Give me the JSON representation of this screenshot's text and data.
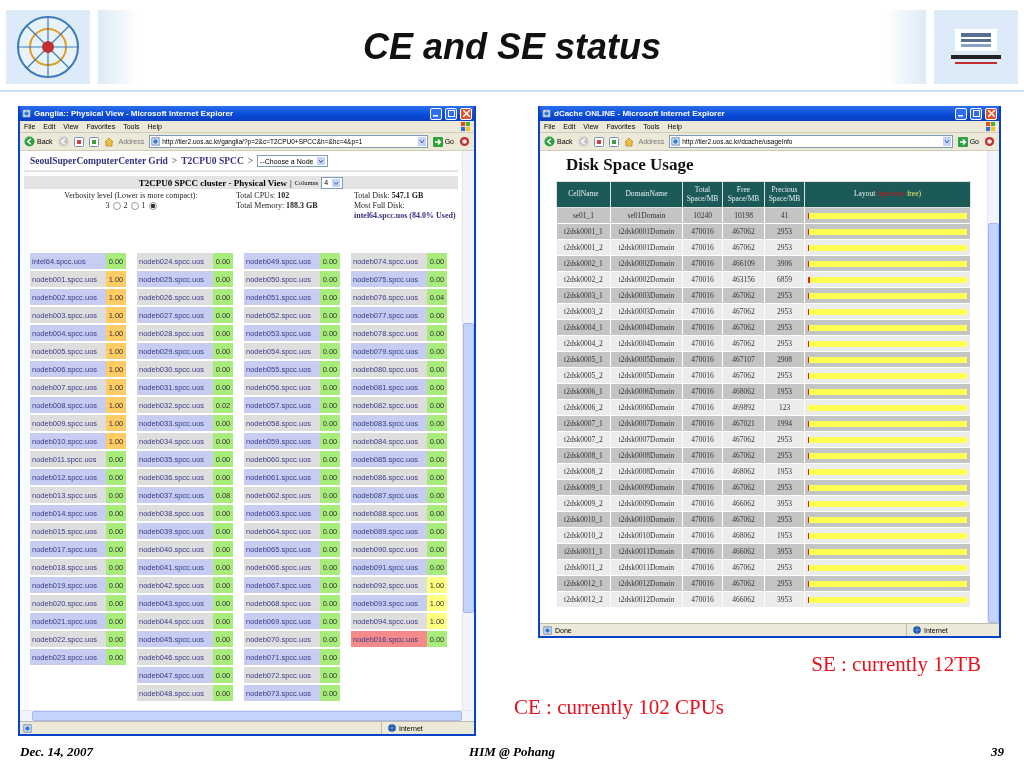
{
  "slide": {
    "title": "CE and SE status",
    "notes": [
      "SE : currently 12TB",
      "CE : currently 102 CPUs"
    ],
    "footer": {
      "date": "Dec. 14, 2007",
      "event": "HIM @ Pohang",
      "page": "39"
    }
  },
  "ganglia_window": {
    "title": "Ganglia:: Physical View - Microsoft Internet Explorer",
    "menu": [
      "File",
      "Edit",
      "View",
      "Favorites",
      "Tools",
      "Help"
    ],
    "back": "Back",
    "address_label": "Address",
    "url": "http://tier2.uos.ac.kr/ganglia/?p=2&c=T2CPU0+SPCC&h=&hc=4&p=1",
    "go": "Go",
    "status": "Internet",
    "breadcrumb": [
      {
        "kind": "link",
        "text": "SeoulSuperComputerCenter Grid"
      },
      {
        "kind": "separator",
        "text": ">"
      },
      {
        "kind": "link",
        "text": "T2CPU0 SPCC"
      },
      {
        "kind": "separator",
        "text": ">"
      }
    ],
    "node_select": "--Choose a Node",
    "cluster_heading": "T2CPU0 SPCC cluster - Physical View",
    "divider": "|",
    "columns_label": "Columns",
    "columns_value": "4",
    "verbosity_label": "Verbosity level (Lower is more compact):",
    "verbosity": [
      {
        "label": "3",
        "selected": false
      },
      {
        "label": "2",
        "selected": false
      },
      {
        "label": "1",
        "selected": true
      }
    ],
    "stats": [
      "Total CPUs: **102**",
      "Total Memory: **188.3 GB**"
    ],
    "disk_stats": [
      "Total Disk: **547.1 GB**",
      "Most Full Disk:"
    ],
    "most_full_link": "intel64.spcc.uos (84.0% Used)",
    "node_columns": [
      [
        {
          "name": "intel64.spcc.uos",
          "load": "0.00",
          "color": "#a8ec7c",
          "down": false
        },
        {
          "name": "nodeb001.spcc.uos",
          "load": "1.00",
          "color": "#ffcc66",
          "down": false
        },
        {
          "name": "nodeb002.spcc.uos",
          "load": "1.00",
          "color": "#ffcc66",
          "down": false
        },
        {
          "name": "nodeb003.spcc.uos",
          "load": "1.00",
          "color": "#ffcc66",
          "down": false
        },
        {
          "name": "nodeb004.spcc.uos",
          "load": "1.00",
          "color": "#ffcc66",
          "down": false
        },
        {
          "name": "nodeb005.spcc.uos",
          "load": "1.00",
          "color": "#ffcc66",
          "down": false
        },
        {
          "name": "nodeb006.spcc.uos",
          "load": "1.00",
          "color": "#ffcc66",
          "down": false
        },
        {
          "name": "nodeb007.spcc.uos",
          "load": "1.00",
          "color": "#ffcc66",
          "down": false
        },
        {
          "name": "nodeb008.spcc.uos",
          "load": "1.00",
          "color": "#ffcc66",
          "down": false
        },
        {
          "name": "nodeb009.spcc.uos",
          "load": "1.00",
          "color": "#ffcc66",
          "down": false
        },
        {
          "name": "nodeb010.spcc.uos",
          "load": "1.00",
          "color": "#ffcc66",
          "down": false
        },
        {
          "name": "nodeb011.spcc.uos",
          "load": "0.00",
          "color": "#a8ec7c",
          "down": false
        },
        {
          "name": "nodeb012.spcc.uos",
          "load": "0.00",
          "color": "#a8ec7c",
          "down": false
        },
        {
          "name": "nodeb013.spcc.uos",
          "load": "0.00",
          "color": "#a8ec7c",
          "down": false
        },
        {
          "name": "nodeb014.spcc.uos",
          "load": "0.00",
          "color": "#a8ec7c",
          "down": false
        },
        {
          "name": "nodeb015.spcc.uos",
          "load": "0.00",
          "color": "#a8ec7c",
          "down": false
        },
        {
          "name": "nodeb017.spcc.uos",
          "load": "0.00",
          "color": "#a8ec7c",
          "down": false
        },
        {
          "name": "nodeb018.spcc.uos",
          "load": "0.00",
          "color": "#a8ec7c",
          "down": false
        },
        {
          "name": "nodeb019.spcc.uos",
          "load": "0.00",
          "color": "#a8ec7c",
          "down": false
        },
        {
          "name": "nodeb020.spcc.uos",
          "load": "0.00",
          "color": "#a8ec7c",
          "down": false
        },
        {
          "name": "nodeb021.spcc.uos",
          "load": "0.00",
          "color": "#a8ec7c",
          "down": false
        },
        {
          "name": "nodeb022.spcc.uos",
          "load": "0.00",
          "color": "#a8ec7c",
          "down": false
        },
        {
          "name": "nodeb023.spcc.uos",
          "load": "0.00",
          "color": "#a8ec7c",
          "down": false
        }
      ],
      [
        {
          "name": "nodeb024.spcc.uos",
          "load": "0.00",
          "color": "#a8ec7c",
          "down": false
        },
        {
          "name": "nodeb025.spcc.uos",
          "load": "0.00",
          "color": "#a8ec7c",
          "down": false
        },
        {
          "name": "nodeb026.spcc.uos",
          "load": "0.00",
          "color": "#a8ec7c",
          "down": false
        },
        {
          "name": "nodeb027.spcc.uos",
          "load": "0.00",
          "color": "#a8ec7c",
          "down": false
        },
        {
          "name": "nodeb028.spcc.uos",
          "load": "0.00",
          "color": "#a8ec7c",
          "down": false
        },
        {
          "name": "nodeb029.spcc.uos",
          "load": "0.00",
          "color": "#a8ec7c",
          "down": false
        },
        {
          "name": "nodeb030.spcc.uos",
          "load": "0.00",
          "color": "#a8ec7c",
          "down": false
        },
        {
          "name": "nodeb031.spcc.uos",
          "load": "0.00",
          "color": "#a8ec7c",
          "down": false
        },
        {
          "name": "nodeb032.spcc.uos",
          "load": "0.02",
          "color": "#a8ec7c",
          "down": false
        },
        {
          "name": "nodeb033.spcc.uos",
          "load": "0.00",
          "color": "#a8ec7c",
          "down": false
        },
        {
          "name": "nodeb034.spcc.uos",
          "load": "0.00",
          "color": "#a8ec7c",
          "down": false
        },
        {
          "name": "nodeb035.spcc.uos",
          "load": "0.00",
          "color": "#a8ec7c",
          "down": false
        },
        {
          "name": "nodeb036.spcc.uos",
          "load": "0.00",
          "color": "#a8ec7c",
          "down": false
        },
        {
          "name": "nodeb037.spcc.uos",
          "load": "0.08",
          "color": "#a8ec7c",
          "down": false
        },
        {
          "name": "nodeb038.spcc.uos",
          "load": "0.00",
          "color": "#a8ec7c",
          "down": false
        },
        {
          "name": "nodeb039.spcc.uos",
          "load": "0.00",
          "color": "#a8ec7c",
          "down": false
        },
        {
          "name": "nodeb040.spcc.uos",
          "load": "0.00",
          "color": "#a8ec7c",
          "down": false
        },
        {
          "name": "nodeb041.spcc.uos",
          "load": "0.00",
          "color": "#a8ec7c",
          "down": false
        },
        {
          "name": "nodeb042.spcc.uos",
          "load": "0.00",
          "color": "#a8ec7c",
          "down": false
        },
        {
          "name": "nodeb043.spcc.uos",
          "load": "0.00",
          "color": "#a8ec7c",
          "down": false
        },
        {
          "name": "nodeb044.spcc.uos",
          "load": "0.00",
          "color": "#a8ec7c",
          "down": false
        },
        {
          "name": "nodeb045.spcc.uos",
          "load": "0.00",
          "color": "#a8ec7c",
          "down": false
        },
        {
          "name": "nodeb046.spcc.uos",
          "load": "0.00",
          "color": "#a8ec7c",
          "down": false
        },
        {
          "name": "nodeb047.spcc.uos",
          "load": "0.00",
          "color": "#a8ec7c",
          "down": false
        },
        {
          "name": "nodeb048.spcc.uos",
          "load": "0.00",
          "color": "#a8ec7c",
          "down": false
        }
      ],
      [
        {
          "name": "nodeb049.spcc.uos",
          "load": "0.00",
          "color": "#a8ec7c",
          "down": false
        },
        {
          "name": "nodeb050.spcc.uos",
          "load": "0.00",
          "color": "#a8ec7c",
          "down": false
        },
        {
          "name": "nodeb051.spcc.uos",
          "load": "0.00",
          "color": "#a8ec7c",
          "down": false
        },
        {
          "name": "nodeb052.spcc.uos",
          "load": "0.00",
          "color": "#a8ec7c",
          "down": false
        },
        {
          "name": "nodeb053.spcc.uos",
          "load": "0.00",
          "color": "#a8ec7c",
          "down": false
        },
        {
          "name": "nodeb054.spcc.uos",
          "load": "0.00",
          "color": "#a8ec7c",
          "down": false
        },
        {
          "name": "nodeb055.spcc.uos",
          "load": "0.00",
          "color": "#a8ec7c",
          "down": false
        },
        {
          "name": "nodeb056.spcc.uos",
          "load": "0.00",
          "color": "#a8ec7c",
          "down": false
        },
        {
          "name": "nodeb057.spcc.uos",
          "load": "0.00",
          "color": "#a8ec7c",
          "down": false
        },
        {
          "name": "nodeb058.spcc.uos",
          "load": "0.00",
          "color": "#a8ec7c",
          "down": false
        },
        {
          "name": "nodeb059.spcc.uos",
          "load": "0.00",
          "color": "#a8ec7c",
          "down": false
        },
        {
          "name": "nodeb060.spcc.uos",
          "load": "0.00",
          "color": "#a8ec7c",
          "down": false
        },
        {
          "name": "nodeb061.spcc.uos",
          "load": "0.00",
          "color": "#a8ec7c",
          "down": false
        },
        {
          "name": "nodeb062.spcc.uos",
          "load": "0.00",
          "color": "#a8ec7c",
          "down": false
        },
        {
          "name": "nodeb063.spcc.uos",
          "load": "0.00",
          "color": "#a8ec7c",
          "down": false
        },
        {
          "name": "nodeb064.spcc.uos",
          "load": "0.00",
          "color": "#a8ec7c",
          "down": false
        },
        {
          "name": "nodeb065.spcc.uos",
          "load": "0.00",
          "color": "#a8ec7c",
          "down": false
        },
        {
          "name": "nodeb066.spcc.uos",
          "load": "0.00",
          "color": "#a8ec7c",
          "down": false
        },
        {
          "name": "nodeb067.spcc.uos",
          "load": "0.00",
          "color": "#a8ec7c",
          "down": false
        },
        {
          "name": "nodeb068.spcc.uos",
          "load": "0.00",
          "color": "#a8ec7c",
          "down": false
        },
        {
          "name": "nodeb069.spcc.uos",
          "load": "0.00",
          "color": "#a8ec7c",
          "down": false
        },
        {
          "name": "nodeb070.spcc.uos",
          "load": "0.00",
          "color": "#a8ec7c",
          "down": false
        },
        {
          "name": "nodeb071.spcc.uos",
          "load": "0.00",
          "color": "#a8ec7c",
          "down": false
        },
        {
          "name": "nodeb072.spcc.uos",
          "load": "0.00",
          "color": "#a8ec7c",
          "down": false
        },
        {
          "name": "nodeb073.spcc.uos",
          "load": "0.00",
          "color": "#a8ec7c",
          "down": false
        }
      ],
      [
        {
          "name": "nodeb074.spcc.uos",
          "load": "0.00",
          "color": "#a8ec7c",
          "down": false
        },
        {
          "name": "nodeb075.spcc.uos",
          "load": "0.00",
          "color": "#a8ec7c",
          "down": false
        },
        {
          "name": "nodeb076.spcc.uos",
          "load": "0.04",
          "color": "#a8ec7c",
          "down": false
        },
        {
          "name": "nodeb077.spcc.uos",
          "load": "0.00",
          "color": "#a8ec7c",
          "down": false
        },
        {
          "name": "nodeb078.spcc.uos",
          "load": "0.00",
          "color": "#a8ec7c",
          "down": false
        },
        {
          "name": "nodeb079.spcc.uos",
          "load": "0.00",
          "color": "#a8ec7c",
          "down": false
        },
        {
          "name": "nodeb080.spcc.uos",
          "load": "0.00",
          "color": "#a8ec7c",
          "down": false
        },
        {
          "name": "nodeb081.spcc.uos",
          "load": "0.00",
          "color": "#a8ec7c",
          "down": false
        },
        {
          "name": "nodeb082.spcc.uos",
          "load": "0.00",
          "color": "#a8ec7c",
          "down": false
        },
        {
          "name": "nodeb083.spcc.uos",
          "load": "0.00",
          "color": "#a8ec7c",
          "down": false
        },
        {
          "name": "nodeb084.spcc.uos",
          "load": "0.00",
          "color": "#a8ec7c",
          "down": false
        },
        {
          "name": "nodeb085.spcc.uos",
          "load": "0.00",
          "color": "#a8ec7c",
          "down": false
        },
        {
          "name": "nodeb086.spcc.uos",
          "load": "0.00",
          "color": "#a8ec7c",
          "down": false
        },
        {
          "name": "nodeb087.spcc.uos",
          "load": "0.00",
          "color": "#a8ec7c",
          "down": false
        },
        {
          "name": "nodeb088.spcc.uos",
          "load": "0.00",
          "color": "#a8ec7c",
          "down": false
        },
        {
          "name": "nodeb089.spcc.uos",
          "load": "0.00",
          "color": "#a8ec7c",
          "down": false
        },
        {
          "name": "nodeb090.spcc.uos",
          "load": "0.00",
          "color": "#a8ec7c",
          "down": false
        },
        {
          "name": "nodeb091.spcc.uos",
          "load": "0.00",
          "color": "#a8ec7c",
          "down": false
        },
        {
          "name": "nodeb092.spcc.uos",
          "load": "1.00",
          "color": "#ffff80",
          "down": false
        },
        {
          "name": "nodeb093.spcc.uos",
          "load": "1.00",
          "color": "#ffff80",
          "down": false
        },
        {
          "name": "nodeb094.spcc.uos",
          "load": "1.00",
          "color": "#ffff80",
          "down": false
        },
        {
          "name": "nodeb016.spcc.uos",
          "load": "0.00",
          "color": "#a8ec7c",
          "down": true
        }
      ]
    ]
  },
  "dcache_window": {
    "title": "dCache ONLINE - Microsoft Internet Explorer",
    "menu": [
      "File",
      "Edit",
      "View",
      "Favorites",
      "Tools",
      "Help"
    ],
    "back": "Back",
    "address_label": "Address",
    "url": "http://tier2.uos.ac.kr/dcache/usageInfo",
    "go": "Go",
    "status": "Done",
    "zone": "Internet",
    "heading": "Disk Space Usage",
    "columns": [
      "CellName",
      "DomainName",
      "Total Space/MB",
      "Free Space/MB",
      "Precious Space/MB",
      "Layout"
    ],
    "legend": [
      {
        "text": "(precious",
        "kind": "precious"
      },
      {
        "text": "free)",
        "kind": "free"
      }
    ],
    "rows": [
      {
        "cell": "se01_1",
        "domain": "se01Domain",
        "total": "10240",
        "free": "10198",
        "precious": "41",
        "level": 0.004
      },
      {
        "cell": "t2dsk0001_1",
        "domain": "t2dsk0001Domain",
        "total": "470016",
        "free": "467062",
        "precious": "2953",
        "level": 0.0063
      },
      {
        "cell": "t2dsk0001_2",
        "domain": "t2dsk0001Domain",
        "total": "470016",
        "free": "467062",
        "precious": "2953",
        "level": 0.0063
      },
      {
        "cell": "t2dsk0002_1",
        "domain": "t2dsk0002Domain",
        "total": "470016",
        "free": "466109",
        "precious": "3906",
        "level": 0.0083
      },
      {
        "cell": "t2dsk0002_2",
        "domain": "t2dsk0002Domain",
        "total": "470016",
        "free": "463156",
        "precious": "6859",
        "level": 0.0146
      },
      {
        "cell": "t2dsk0003_1",
        "domain": "t2dsk0003Domain",
        "total": "470016",
        "free": "467062",
        "precious": "2953",
        "level": 0.0063
      },
      {
        "cell": "t2dsk0003_2",
        "domain": "t2dsk0003Domain",
        "total": "470016",
        "free": "467062",
        "precious": "2953",
        "level": 0.0063
      },
      {
        "cell": "t2dsk0004_1",
        "domain": "t2dsk0004Domain",
        "total": "470016",
        "free": "467062",
        "precious": "2953",
        "level": 0.0063
      },
      {
        "cell": "t2dsk0004_2",
        "domain": "t2dsk0004Domain",
        "total": "470016",
        "free": "467062",
        "precious": "2953",
        "level": 0.0063
      },
      {
        "cell": "t2dsk0005_1",
        "domain": "t2dsk0005Domain",
        "total": "470016",
        "free": "467107",
        "precious": "2908",
        "level": 0.0062
      },
      {
        "cell": "t2dsk0005_2",
        "domain": "t2dsk0005Domain",
        "total": "470016",
        "free": "467062",
        "precious": "2953",
        "level": 0.0063
      },
      {
        "cell": "t2dsk0006_1",
        "domain": "t2dsk0006Domain",
        "total": "470016",
        "free": "468062",
        "precious": "1953",
        "level": 0.0042
      },
      {
        "cell": "t2dsk0006_2",
        "domain": "t2dsk0006Domain",
        "total": "470016",
        "free": "469892",
        "precious": "123",
        "level": 0.0003
      },
      {
        "cell": "t2dsk0007_1",
        "domain": "t2dsk0007Domain",
        "total": "470016",
        "free": "467021",
        "precious": "1994",
        "level": 0.0042
      },
      {
        "cell": "t2dsk0007_2",
        "domain": "t2dsk0007Domain",
        "total": "470016",
        "free": "467062",
        "precious": "2953",
        "level": 0.0063
      },
      {
        "cell": "t2dsk0008_1",
        "domain": "t2dsk0008Domain",
        "total": "470016",
        "free": "467062",
        "precious": "2953",
        "level": 0.0063
      },
      {
        "cell": "t2dsk0008_2",
        "domain": "t2dsk0008Domain",
        "total": "470016",
        "free": "468062",
        "precious": "1953",
        "level": 0.0042
      },
      {
        "cell": "t2dsk0009_1",
        "domain": "t2dsk0009Domain",
        "total": "470016",
        "free": "467062",
        "precious": "2953",
        "level": 0.0063
      },
      {
        "cell": "t2dsk0009_2",
        "domain": "t2dsk0009Domain",
        "total": "470016",
        "free": "466062",
        "precious": "3953",
        "level": 0.0084
      },
      {
        "cell": "t2dsk0010_1",
        "domain": "t2dsk0010Domain",
        "total": "470016",
        "free": "467062",
        "precious": "2953",
        "level": 0.0063
      },
      {
        "cell": "t2dsk0010_2",
        "domain": "t2dsk0010Domain",
        "total": "470016",
        "free": "468062",
        "precious": "1953",
        "level": 0.0042
      },
      {
        "cell": "t2dsk0011_1",
        "domain": "t2dsk0011Domain",
        "total": "470016",
        "free": "466062",
        "precious": "3953",
        "level": 0.0084
      },
      {
        "cell": "t2dsk0011_2",
        "domain": "t2dsk0011Domain",
        "total": "470016",
        "free": "467062",
        "precious": "2953",
        "level": 0.0063
      },
      {
        "cell": "t2dsk0012_1",
        "domain": "t2dsk0012Domain",
        "total": "470016",
        "free": "467062",
        "precious": "2953",
        "level": 0.0063
      },
      {
        "cell": "t2dsk0012_2",
        "domain": "t2dsk0012Domain",
        "total": "470016",
        "free": "466062",
        "precious": "3953",
        "level": 0.0084
      }
    ]
  }
}
